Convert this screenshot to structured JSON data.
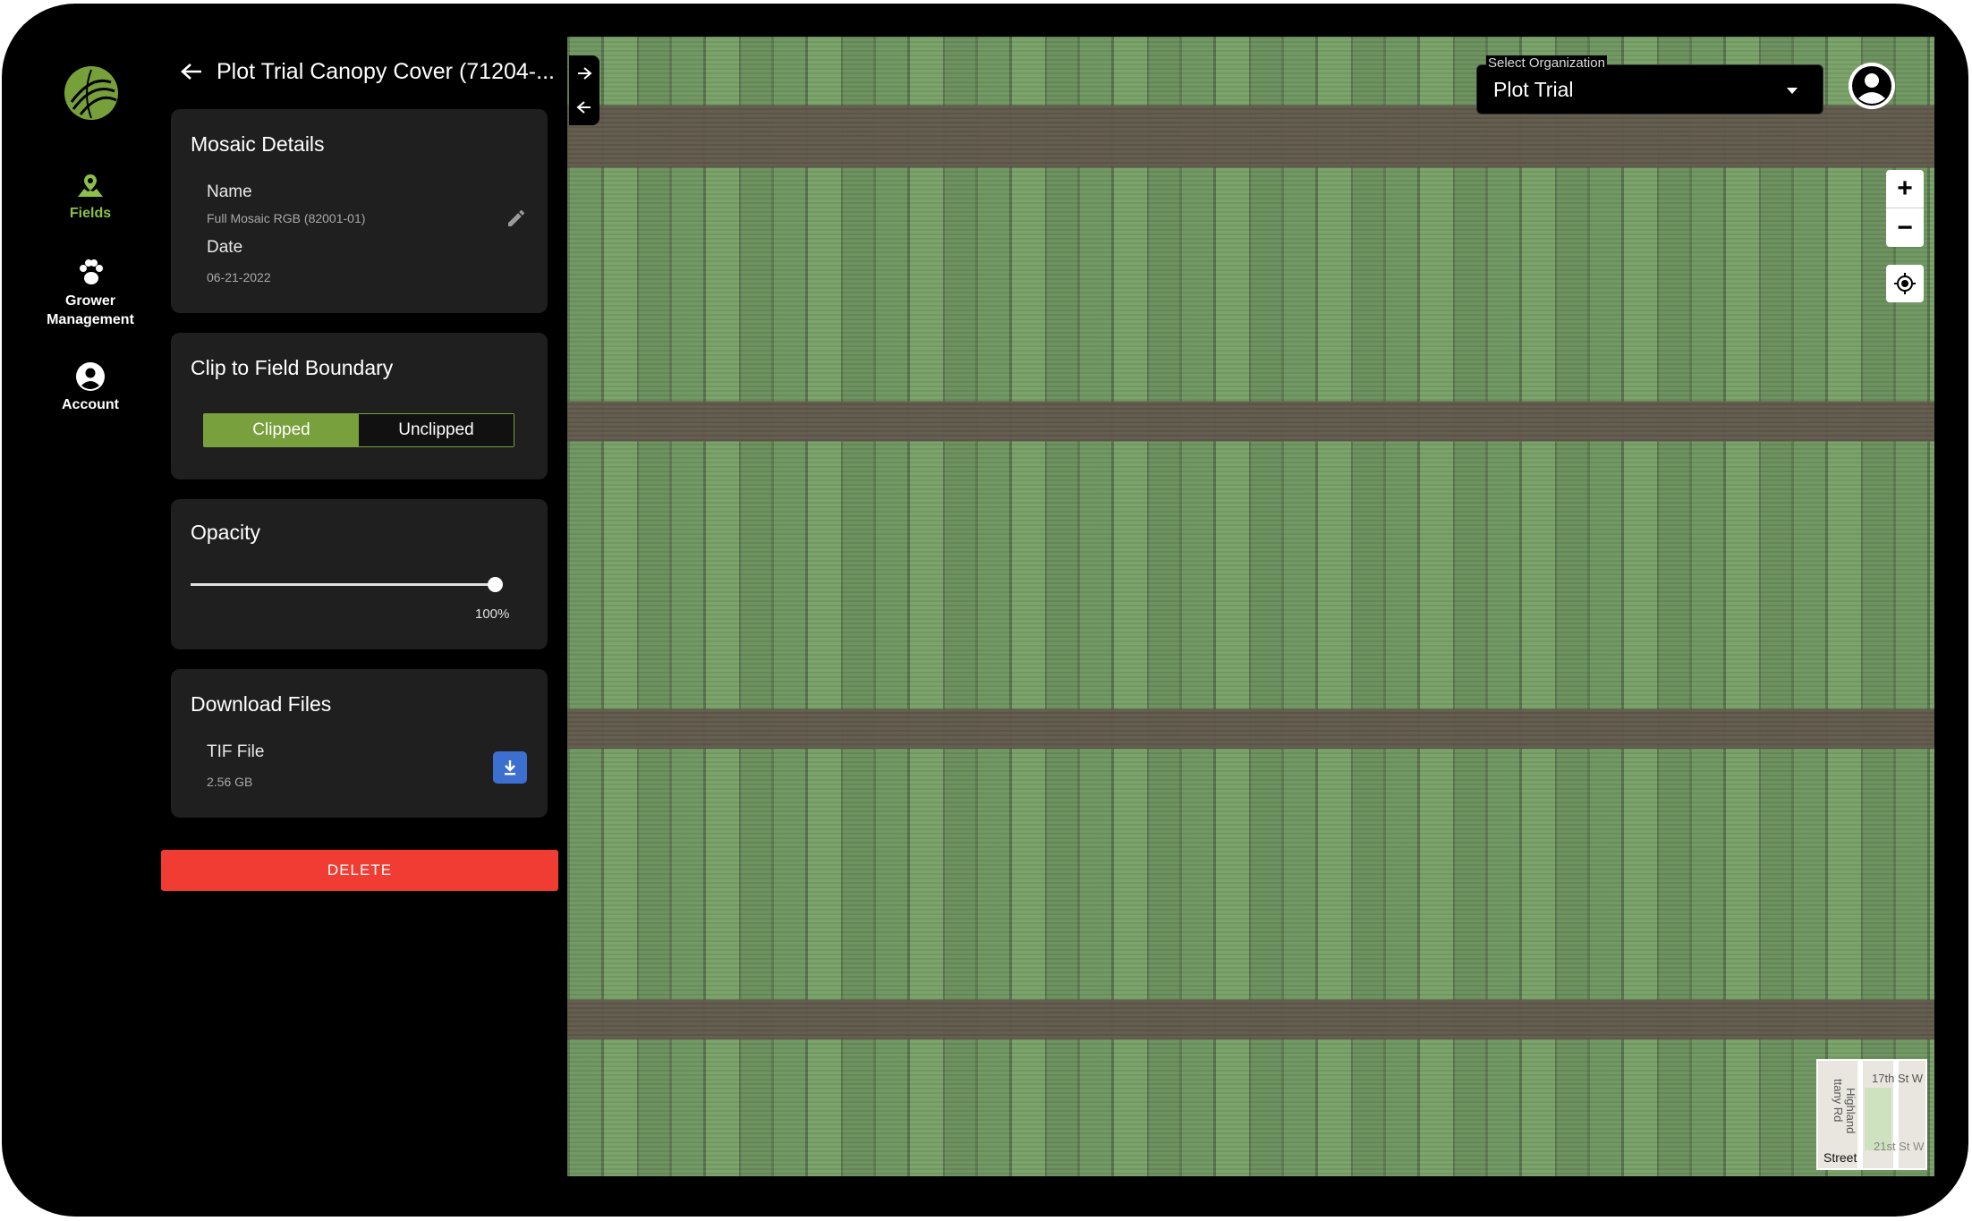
{
  "nav": {
    "items": [
      {
        "label": "Fields",
        "active": true
      },
      {
        "label": "Grower\nManagement",
        "line1": "Grower",
        "line2": "Management"
      },
      {
        "label": "Account"
      }
    ],
    "active_color": "#8cc04a"
  },
  "panel": {
    "title": "Plot Trial Canopy Cover (71204-...",
    "mosaic": {
      "heading": "Mosaic Details",
      "name_label": "Name",
      "name_value": "Full Mosaic RGB (82001-01)",
      "date_label": "Date",
      "date_value": "06-21-2022"
    },
    "clip": {
      "heading": "Clip to Field Boundary",
      "options": [
        "Clipped",
        "Unclipped"
      ],
      "selected": "Clipped"
    },
    "opacity": {
      "heading": "Opacity",
      "value": 100,
      "value_text": "100%"
    },
    "download": {
      "heading": "Download Files",
      "file_label": "TIF File",
      "file_size": "2.56 GB"
    },
    "delete_label": "DELETE"
  },
  "map": {
    "org_select": {
      "legend": "Select Organization",
      "value": "Plot Trial"
    },
    "zoom_in": "+",
    "zoom_out": "−",
    "minimap": {
      "labels": [
        "17th St W",
        "ttany Rd",
        "Highland",
        "21st St W"
      ],
      "basemap": "Street"
    }
  },
  "colors": {
    "accent_green": "#78a03c",
    "delete_red": "#f03c32",
    "download_blue": "#3d6fd1"
  }
}
